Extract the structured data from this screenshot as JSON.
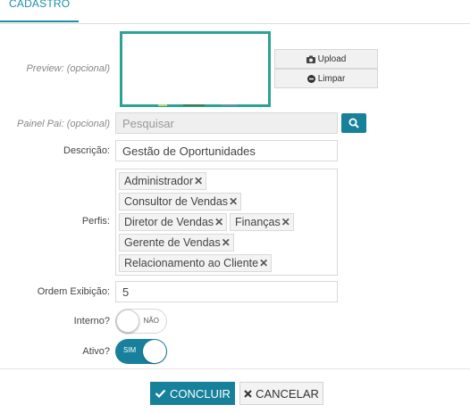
{
  "tabs": {
    "active": "CADASTRO"
  },
  "form": {
    "preview_label": "Preview: (opcional)",
    "upload_label": "Upload",
    "clear_label": "Limpar",
    "parent_label": "Painel Pai: (opcional)",
    "parent_placeholder": "Pesquisar",
    "description_label": "Descrição:",
    "description_value": "Gestão de Oportunidades",
    "profiles_label": "Perfis:",
    "profiles": [
      "Administrador",
      "Consultor de Vendas",
      "Diretor de Vendas",
      "Finanças",
      "Gerente de Vendas",
      "Relacionamento ao Cliente"
    ],
    "order_label": "Ordem Exibição:",
    "order_value": "5",
    "internal_label": "Interno?",
    "internal_toggle": "NÃO",
    "active_label": "Ativo?",
    "active_toggle": "SIM"
  },
  "footer": {
    "confirm_label": "CONCLUIR",
    "cancel_label": "CANCELAR"
  },
  "colors": {
    "accent": "#17809b",
    "preview_border": "#2aa394"
  }
}
